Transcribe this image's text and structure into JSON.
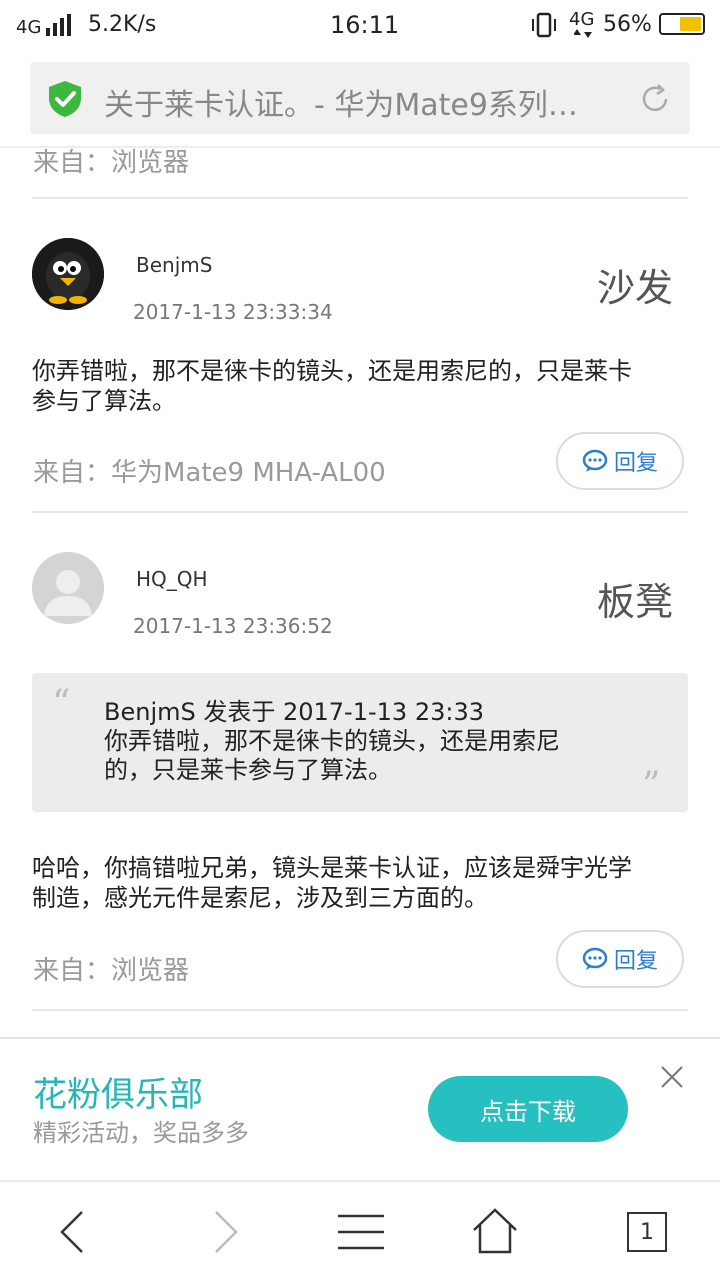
{
  "status_bar": {
    "network_left": "4G",
    "speed": "5.2K/s",
    "time": "16:11",
    "network_right": "4G",
    "battery": "56%",
    "battery_level": 0.56
  },
  "address_bar": {
    "title": "关于莱卡认证。- 华为Mate9系列…"
  },
  "top_meta": {
    "from": "来自：浏览器"
  },
  "posts": [
    {
      "username": "BenjmS",
      "time": "2017-1-13 23:33:34",
      "floor": "沙发",
      "content": "你弄错啦，那不是徕卡的镜头，还是用索尼的，只是莱卡参与了算法。",
      "content_lines": [
        "你弄错啦，那不是徕卡的镜头，还是用索尼的，只是莱卡",
        "参与了算法。"
      ],
      "from": "来自：华为Mate9 MHA-AL00",
      "reply_label": "回复"
    },
    {
      "username": "HQ_QH",
      "time": "2017-1-13 23:36:52",
      "floor": "板凳",
      "quote_header": "BenjmS 发表于 2017-1-13 23:33",
      "quote_lines": [
        "你弄错啦，那不是徕卡的镜头，还是用索尼",
        "的，只是莱卡参与了算法。"
      ],
      "content_lines": [
        "哈哈，你搞错啦兄弟，镜头是莱卡认证，应该是舜宇光学",
        "制造，感光元件是索尼，涉及到三方面的。"
      ],
      "from": "来自：浏览器",
      "reply_label": "回复"
    }
  ],
  "banner": {
    "title": "花粉俱乐部",
    "subtitle": "精彩活动，奖品多多",
    "button": "点击下载"
  },
  "nav": {
    "tabs_count": "1"
  },
  "colors": {
    "accent_teal": "#26c0c0",
    "shield_green": "#3cb83c",
    "reply_blue": "#2b7fd0",
    "battery_yellow": "#f2c200"
  }
}
